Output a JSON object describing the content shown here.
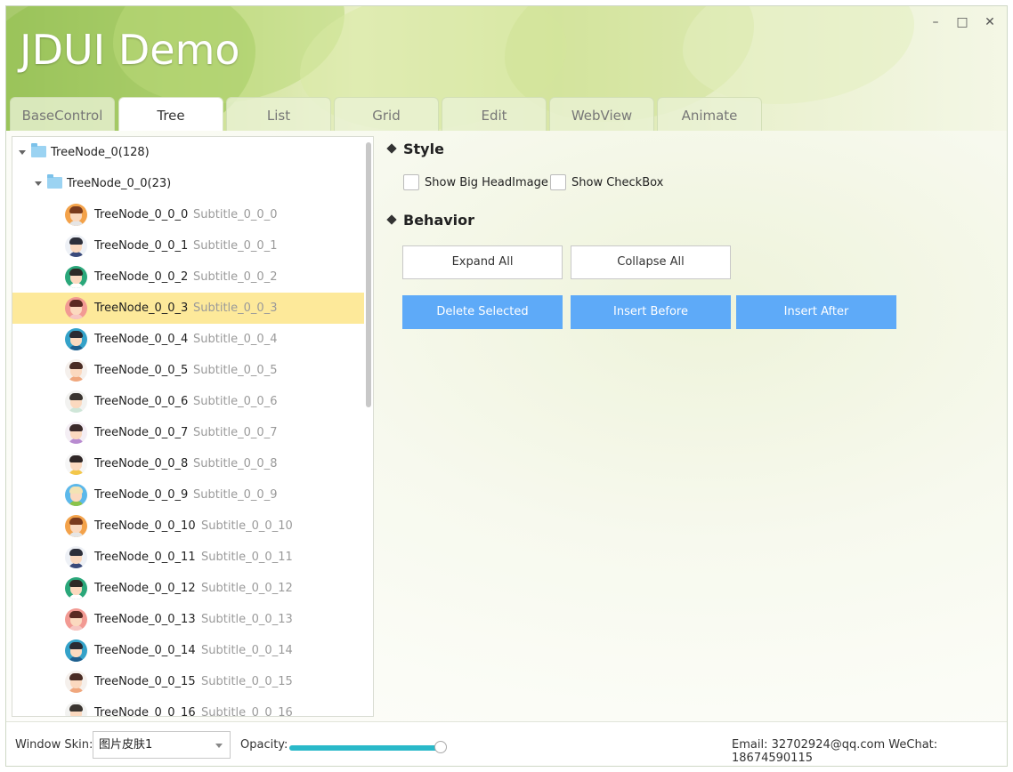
{
  "window": {
    "title": "JDUI Demo",
    "minimize_label": "–",
    "maximize_label": "□",
    "close_label": "✕"
  },
  "tabs": [
    {
      "label": "BaseControl"
    },
    {
      "label": "Tree",
      "active": true
    },
    {
      "label": "List"
    },
    {
      "label": "Grid"
    },
    {
      "label": "Edit"
    },
    {
      "label": "WebView"
    },
    {
      "label": "Animate"
    }
  ],
  "tree": {
    "root": {
      "label": "TreeNode_0(128)",
      "icon": "folder-icon",
      "expanded": true
    },
    "child": {
      "label": "TreeNode_0_0(23)",
      "icon": "folder-icon",
      "expanded": true
    },
    "items": [
      {
        "title": "TreeNode_0_0_0",
        "subtitle": "Subtitle_0_0_0",
        "avatar": "avatar-girl-orange"
      },
      {
        "title": "TreeNode_0_0_1",
        "subtitle": "Subtitle_0_0_1",
        "avatar": "avatar-man-suit"
      },
      {
        "title": "TreeNode_0_0_2",
        "subtitle": "Subtitle_0_0_2",
        "avatar": "avatar-man-green"
      },
      {
        "title": "TreeNode_0_0_3",
        "subtitle": "Subtitle_0_0_3",
        "avatar": "avatar-girl-pink",
        "selected": true
      },
      {
        "title": "TreeNode_0_0_4",
        "subtitle": "Subtitle_0_0_4",
        "avatar": "avatar-man-blue"
      },
      {
        "title": "TreeNode_0_0_5",
        "subtitle": "Subtitle_0_0_5",
        "avatar": "avatar-girl-light"
      },
      {
        "title": "TreeNode_0_0_6",
        "subtitle": "Subtitle_0_0_6",
        "avatar": "avatar-man-light"
      },
      {
        "title": "TreeNode_0_0_7",
        "subtitle": "Subtitle_0_0_7",
        "avatar": "avatar-girl-purple"
      },
      {
        "title": "TreeNode_0_0_8",
        "subtitle": "Subtitle_0_0_8",
        "avatar": "avatar-girl-white"
      },
      {
        "title": "TreeNode_0_0_9",
        "subtitle": "Subtitle_0_0_9",
        "avatar": "avatar-boy-blue"
      },
      {
        "title": "TreeNode_0_0_10",
        "subtitle": "Subtitle_0_0_10",
        "avatar": "avatar-girl-orange"
      },
      {
        "title": "TreeNode_0_0_11",
        "subtitle": "Subtitle_0_0_11",
        "avatar": "avatar-man-suit"
      },
      {
        "title": "TreeNode_0_0_12",
        "subtitle": "Subtitle_0_0_12",
        "avatar": "avatar-man-green"
      },
      {
        "title": "TreeNode_0_0_13",
        "subtitle": "Subtitle_0_0_13",
        "avatar": "avatar-girl-pink"
      },
      {
        "title": "TreeNode_0_0_14",
        "subtitle": "Subtitle_0_0_14",
        "avatar": "avatar-man-blue"
      },
      {
        "title": "TreeNode_0_0_15",
        "subtitle": "Subtitle_0_0_15",
        "avatar": "avatar-girl-light"
      },
      {
        "title": "TreeNode_0_0_16",
        "subtitle": "Subtitle_0_0_16",
        "avatar": "avatar-man-light"
      }
    ]
  },
  "style_section": {
    "title": "Style",
    "checkboxes": [
      {
        "label": "Show Big HeadImage",
        "checked": false
      },
      {
        "label": "Show CheckBox",
        "checked": false
      }
    ]
  },
  "behavior_section": {
    "title": "Behavior",
    "expand_all": "Expand All",
    "collapse_all": "Collapse All",
    "delete_selected": "Delete Selected",
    "insert_before": "Insert Before",
    "insert_after": "Insert After"
  },
  "footer": {
    "skin_label": "Window Skin:",
    "skin_value": "图片皮肤1",
    "opacity_label": "Opacity:",
    "opacity_value": 1.0,
    "contact": "Email: 32702924@qq.com WeChat: 18674590115"
  },
  "colors": {
    "selected_row": "#fde99a",
    "primary_button": "#5eaaf8",
    "slider_fill": "#2ab9c9",
    "folder": "#9bd3f2"
  }
}
